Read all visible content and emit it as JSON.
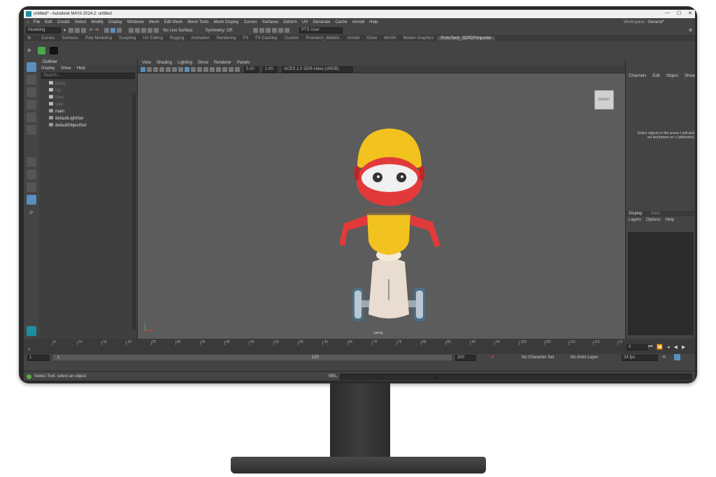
{
  "window": {
    "title": "untitled* - Autodesk MAYA 2024.2: untitled"
  },
  "menu": [
    "File",
    "Edit",
    "Create",
    "Select",
    "Modify",
    "Display",
    "Windows",
    "Mesh",
    "Edit Mesh",
    "Mesh Tools",
    "Mesh Display",
    "Curves",
    "Surfaces",
    "Deform",
    "UV",
    "Generate",
    "Cache",
    "Arnold",
    "Help"
  ],
  "workspace": {
    "label": "Workspace:",
    "value": "General*"
  },
  "status_line": {
    "mode": "Modeling",
    "live_surface": "No Live Surface",
    "symmetry": "Symmetry: Off",
    "user": "PTS User"
  },
  "shelf_tabs": [
    "Curves",
    "Surfaces",
    "Poly Modeling",
    "Sculpting",
    "UV Editing",
    "Rigging",
    "Animation",
    "Rendering",
    "FX",
    "FX Caching",
    "Custom",
    "Prototech_WebGL",
    "Arnold",
    "XGen",
    "MASH",
    "Motion Graphics",
    "ProtoTech_3DPDFImporter"
  ],
  "shelf_active": "ProtoTech_3DPDFImporter",
  "outliner": {
    "title": "Outliner",
    "menu": [
      "Display",
      "Show",
      "Help"
    ],
    "search_placeholder": "Search...",
    "items": [
      {
        "label": "persp",
        "dim": true
      },
      {
        "label": "top",
        "dim": true
      },
      {
        "label": "front",
        "dim": true
      },
      {
        "label": "side",
        "dim": true
      },
      {
        "label": "main",
        "dim": false
      },
      {
        "label": "defaultLightSet",
        "dim": false
      },
      {
        "label": "defaultObjectSet",
        "dim": false
      }
    ]
  },
  "viewport": {
    "menu": [
      "View",
      "Shading",
      "Lighting",
      "Show",
      "Renderer",
      "Panels"
    ],
    "exposure": "0.00",
    "gamma": "1.00",
    "color_space": "ACES 1.0 SDR-video (sRGB)",
    "camera_label": "persp",
    "viewcube_label": "FRONT"
  },
  "channel_box": {
    "tabs": [
      "Channels",
      "Edit",
      "Object",
      "Show"
    ],
    "message": "Select objects in the scene t edit and set keyframes on c (attributes)",
    "layer_tabs": [
      "Display",
      "Anim"
    ],
    "layer_menu": [
      "Layers",
      "Options",
      "Help"
    ]
  },
  "timeline": {
    "ticks": [
      "5",
      "10",
      "15",
      "20",
      "25",
      "30",
      "35",
      "40",
      "45",
      "50",
      "55",
      "60",
      "65",
      "70",
      "75",
      "80",
      "85",
      "90",
      "95",
      "100",
      "105",
      "110",
      "115",
      "12"
    ],
    "start_marker": "0",
    "current_frame": "0"
  },
  "range": {
    "start": "1",
    "range_start": "1",
    "range_end": "120",
    "end": "200",
    "character_set": "No Character Set",
    "anim_layer": "No Anim Layer",
    "fps": "24 fps"
  },
  "help_line": {
    "text": "Select Tool: select an object",
    "mel": "MEL"
  }
}
